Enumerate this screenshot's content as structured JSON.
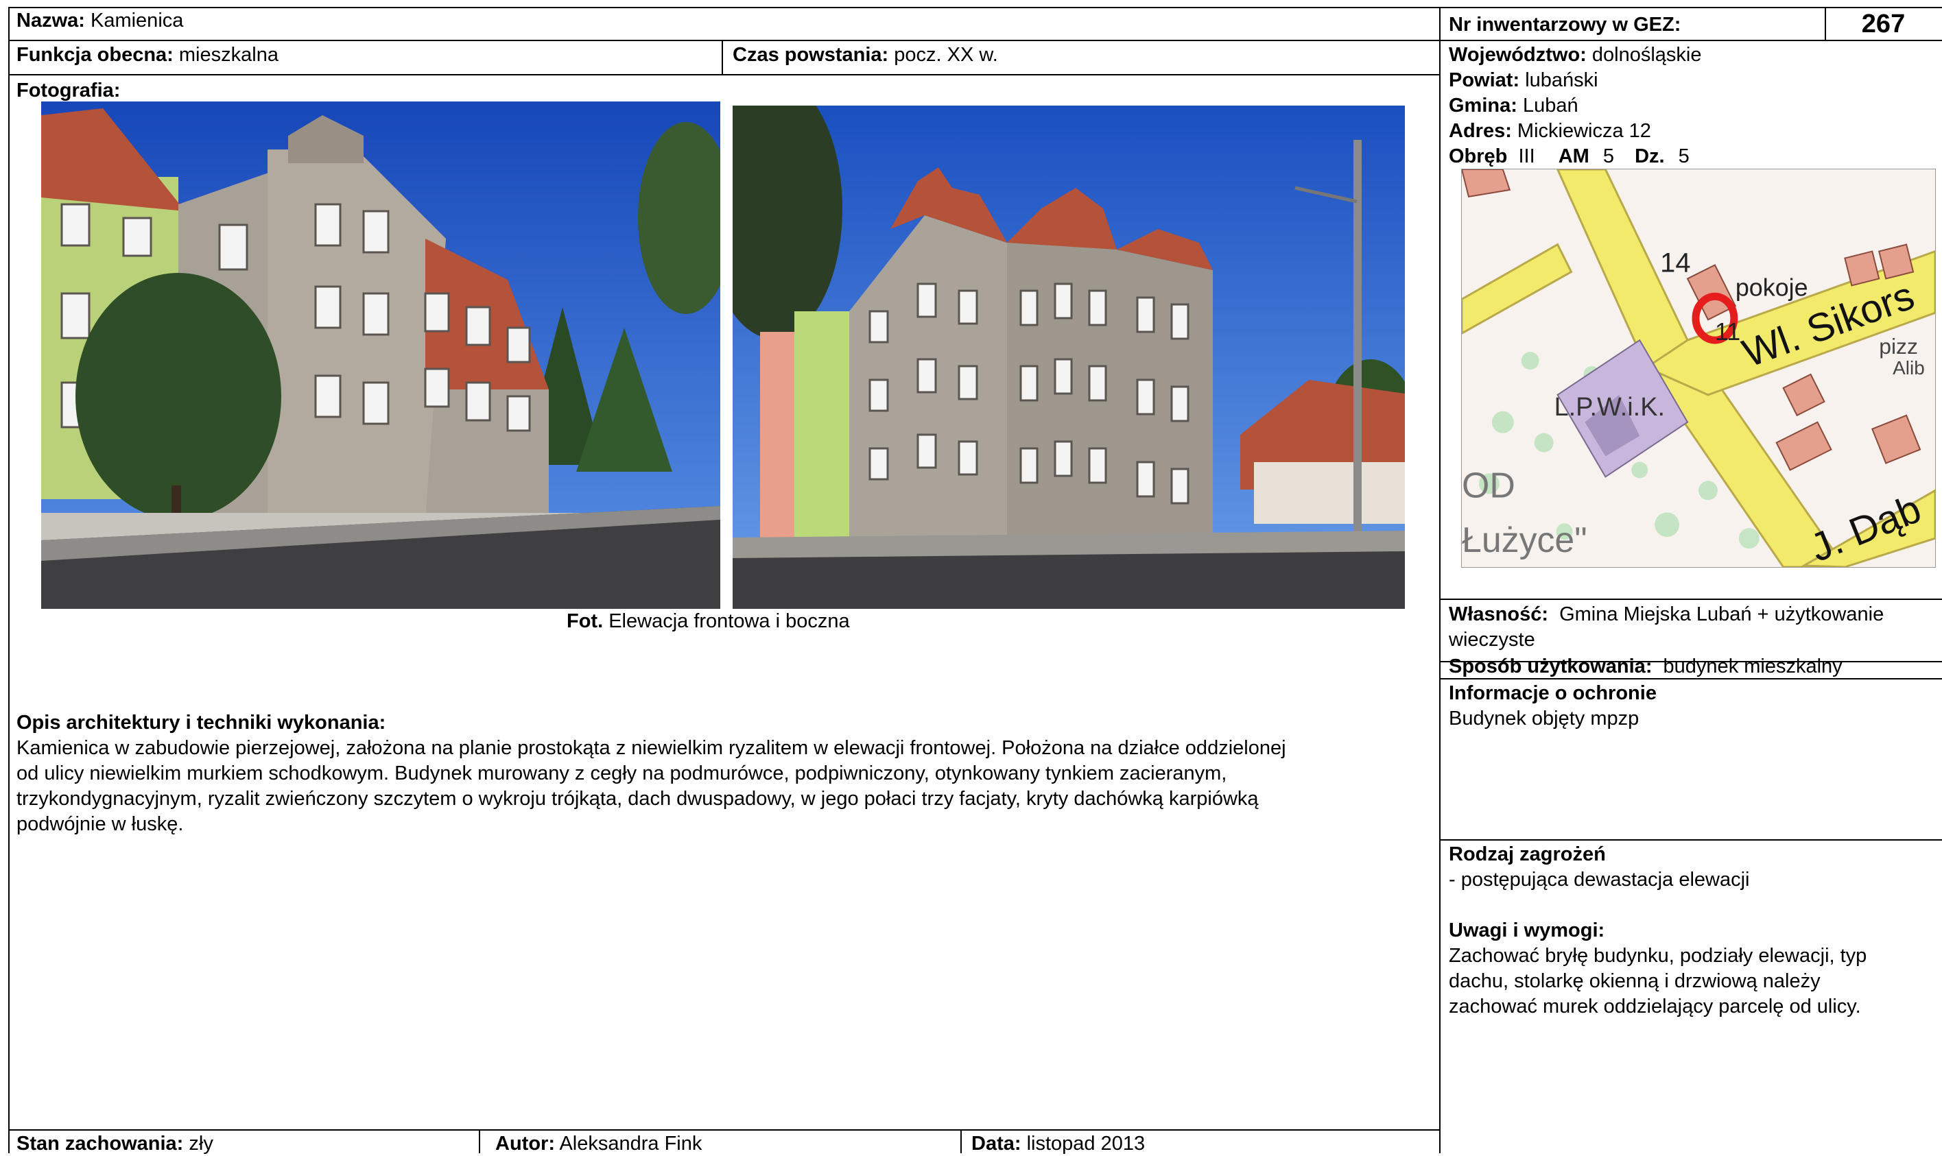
{
  "left": {
    "name": {
      "label": "Nazwa:",
      "value": "Kamienica"
    },
    "function": {
      "label": "Funkcja obecna:",
      "value": "mieszkalna"
    },
    "period": {
      "label": "Czas powstania:",
      "value": "pocz. XX w."
    },
    "photo_label": "Fotografia:",
    "caption": {
      "bold": "Fot.",
      "text": "Elewacja frontowa i boczna"
    },
    "description": {
      "heading": "Opis architektury i techniki wykonania:",
      "lines": [
        "Kamienica w zabudowie pierzejowej, założona na planie prostokąta z niewielkim ryzalitem w elewacji frontowej. Położona na działce oddzielonej",
        "od ulicy niewielkim murkiem schodkowym. Budynek murowany z cegły na podmurówce, podpiwniczony, otynkowany tynkiem zacieranym,",
        "trzykondygnacyjnym, ryzalit zwieńczony szczytem o wykroju trójkąta, dach dwuspadowy, w jego połaci trzy facjaty, kryty dachówką karpiówką",
        "podwójnie w łuskę."
      ]
    },
    "footer": {
      "condition": {
        "label": "Stan zachowania:",
        "value": "zły"
      },
      "author": {
        "label": "Autor:",
        "value": "Aleksandra Fink"
      },
      "date": {
        "label": "Data:",
        "value": "listopad 2013"
      }
    }
  },
  "right": {
    "inventory": {
      "label": "Nr inwentarzowy w GEZ:",
      "value": "267"
    },
    "voivodeship": {
      "label": "Województwo:",
      "value": "dolnośląskie"
    },
    "county": {
      "label": "Powiat:",
      "value": "lubański"
    },
    "commune": {
      "label": "Gmina:",
      "value": "Lubań"
    },
    "address": {
      "label": "Adres:",
      "value": "Mickiewicza 12"
    },
    "plot": {
      "obreb_label": "Obręb",
      "obreb": "III",
      "am_label": "AM",
      "am": "5",
      "dz_label": "Dz.",
      "dz": "5"
    },
    "map_labels": {
      "num14": "14",
      "pokoje": "pokoje",
      "street1": "Wl. Sikors",
      "num11": "11",
      "lpwik": "L.P.W.i.K.",
      "pizz": "pizz",
      "alib": "Alib",
      "od": "OD",
      "luzyce": "Łużyce\"",
      "street2": "J. Dąb"
    },
    "ownership": {
      "label": "Własność:",
      "line1": "Gmina Miejska Lubań + użytkowanie",
      "line2": "wieczyste"
    },
    "usage": {
      "label": "Sposób użytkowania:",
      "value": "budynek mieszkalny"
    },
    "protection": {
      "heading": "Informacje o ochronie",
      "text": "Budynek objęty mpzp"
    },
    "threats": {
      "heading": "Rodzaj zagrożeń",
      "text": "- postępująca dewastacja elewacji"
    },
    "remarks": {
      "heading": "Uwagi i wymogi:",
      "lines": [
        "Zachować bryłę budynku, podziały elewacji, typ",
        "dachu, stolarkę okienną i drzwiową należy",
        "zachować murek oddzielający parcelę od ulicy."
      ]
    }
  },
  "colors": {
    "sky": "#1f5fc8",
    "facade_gray": "#a09b95",
    "roof": "#b5523a",
    "map_road": "#f2ea6a",
    "map_marker": "#e51d1d"
  }
}
